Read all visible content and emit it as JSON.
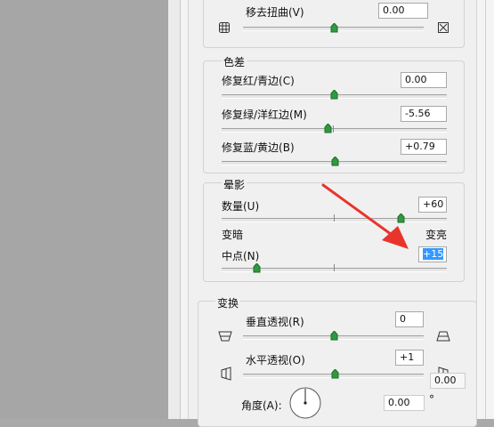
{
  "distortion": {
    "label": "移去扭曲(V)",
    "value": "0.00"
  },
  "chromatic": {
    "title": "色差",
    "red_cyan": {
      "label": "修复红/青边(C)",
      "value": "0.00"
    },
    "green_magenta": {
      "label": "修复绿/洋红边(M)",
      "value": "-5.56"
    },
    "blue_yellow": {
      "label": "修复蓝/黄边(B)",
      "value": "+0.79"
    }
  },
  "vignette": {
    "title": "晕影",
    "amount": {
      "label": "数量(U)",
      "value": "+60"
    },
    "darken": "变暗",
    "lighten": "变亮",
    "midpoint": {
      "label": "中点(N)",
      "value": "+15"
    }
  },
  "transform": {
    "title": "变换",
    "vertical": {
      "label": "垂直透视(R)",
      "value": "0"
    },
    "horizontal": {
      "label": "水平透视(O)",
      "value": "+1"
    },
    "angle": {
      "label": "角度(A):",
      "value": "0.00",
      "degree_symbol": "°"
    },
    "partial_value": "0.00"
  },
  "colors": {
    "accent": "#3399ff",
    "thumb": "#2e9b3e",
    "arrow": "#e8342b"
  }
}
